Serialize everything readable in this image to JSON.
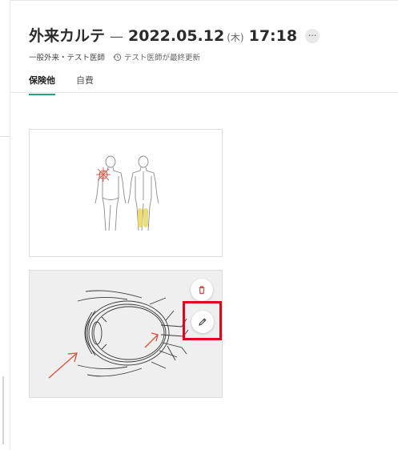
{
  "header": {
    "title": "外来カルテ",
    "dash": "—",
    "date": "2022.05.12",
    "weekday": "(木)",
    "time": "17:18",
    "more_icon": "more-horizontal-icon",
    "more_glyph": "···",
    "department": "一般外来・テスト医師",
    "history_icon": "history-icon",
    "last_updated": "テスト医師が最終更新"
  },
  "tabs": [
    {
      "label": "保険他",
      "active": true
    },
    {
      "label": "自費",
      "active": false
    }
  ],
  "attachments": [
    {
      "name": "body-chart-image",
      "kind": "body-diagram"
    },
    {
      "name": "eye-diagram-image",
      "kind": "eye-cross-section"
    }
  ],
  "actions": {
    "delete_icon": "trash-icon",
    "edit_icon": "pencil-icon"
  },
  "colors": {
    "accent": "#2aa27e",
    "delete": "#d9413a",
    "highlight": "#e0061b",
    "annotation": "#d9503a",
    "marker_yellow": "#e8d24a"
  }
}
